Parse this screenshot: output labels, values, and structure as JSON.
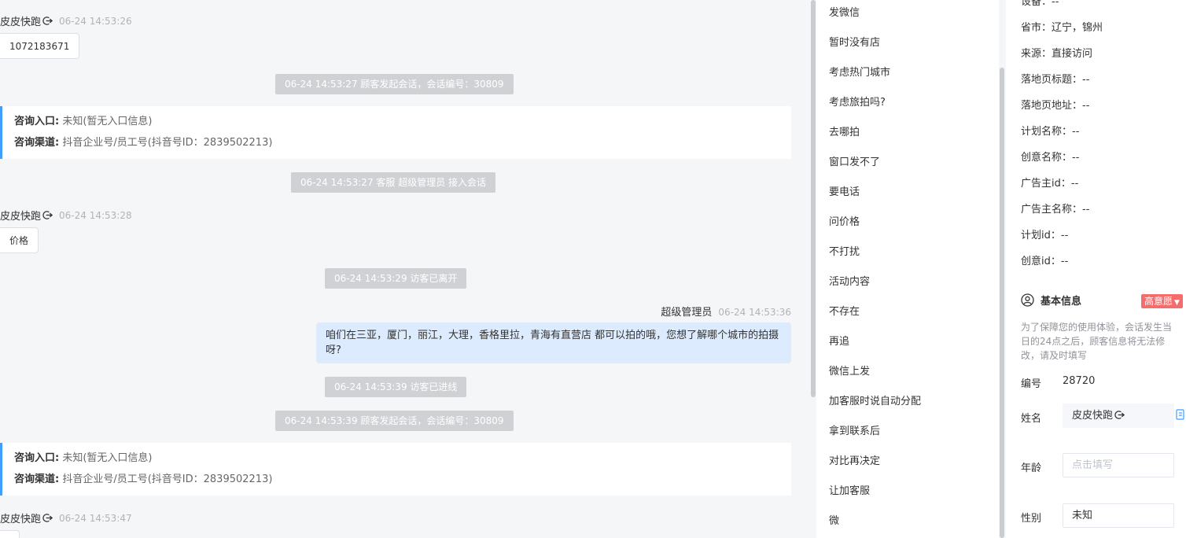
{
  "chat": {
    "entries": [
      {
        "name": "皮皮快跑",
        "time": "06-24 14:53:26"
      },
      {
        "bubble": "1072183671"
      },
      {
        "system": "06-24 14:53:27 顾客发起会话，会话编号：30809"
      },
      {
        "system": "06-24 14:53:27 客服 超级管理员 接入会话"
      },
      {
        "name": "皮皮快跑",
        "time": "06-24 14:53:28"
      },
      {
        "bubble": "价格"
      },
      {
        "system": "06-24 14:53:29 访客已离开"
      },
      {
        "system": "06-24 14:53:39 访客已进线"
      },
      {
        "system": "06-24 14:53:39 顾客发起会话，会话编号：30809"
      },
      {
        "name": "皮皮快跑",
        "time": "06-24 14:53:47"
      }
    ],
    "info_card": {
      "entry_label": "咨询入口:",
      "entry_value": "未知(暂无入口信息)",
      "channel_label": "咨询渠道:",
      "channel_value": "抖音企业号/员工号(抖音号ID：2839502213)"
    },
    "agent": {
      "name": "超级管理员",
      "time": "06-24 14:53:36",
      "message": "咱们在三亚，厦门，丽江，大理，香格里拉，青海有直营店 都可以拍的哦，您想了解哪个城市的拍摄呀?"
    }
  },
  "quick_replies": [
    "发微信",
    "暂时没有店",
    "考虑热门城市",
    "考虑旅拍吗?",
    "去哪拍",
    "窗口发不了",
    "要电话",
    "问价格",
    "不打扰",
    "活动内容",
    "不存在",
    "再追",
    "微信上发",
    "加客服时说自动分配",
    "拿到联系后",
    "对比再决定",
    "让加客服",
    "微"
  ],
  "info": {
    "partial_top": "设备：--",
    "source_fields": [
      {
        "label": "省市：",
        "value": "辽宁，锦州"
      },
      {
        "label": "来源：",
        "value": "直接访问"
      },
      {
        "label": "落地页标题：",
        "value": "--"
      },
      {
        "label": "落地页地址：",
        "value": "--"
      },
      {
        "label": "计划名称：",
        "value": "--"
      },
      {
        "label": "创意名称：",
        "value": "--"
      },
      {
        "label": "广告主id：",
        "value": "--"
      },
      {
        "label": "广告主名称：",
        "value": "--"
      },
      {
        "label": "计划id：",
        "value": "--"
      },
      {
        "label": "创意id：",
        "value": "--"
      }
    ],
    "section_title": "基本信息",
    "intent_badge": "高意愿",
    "notice": "为了保障您的使用体验，会话发生当日的24点之后，顾客信息将无法修改，请及时填写",
    "id_label": "编号",
    "id_value": "28720",
    "name_label": "姓名",
    "name_value": "皮皮快跑",
    "age_label": "年龄",
    "age_placeholder": "点击填写",
    "gender_label": "性别",
    "gender_value": "未知"
  },
  "colors": {
    "accent": "#409eff",
    "badge": "#f56c6c",
    "agent_bubble": "#dcebfd",
    "system_bg": "#cfd1d4"
  }
}
